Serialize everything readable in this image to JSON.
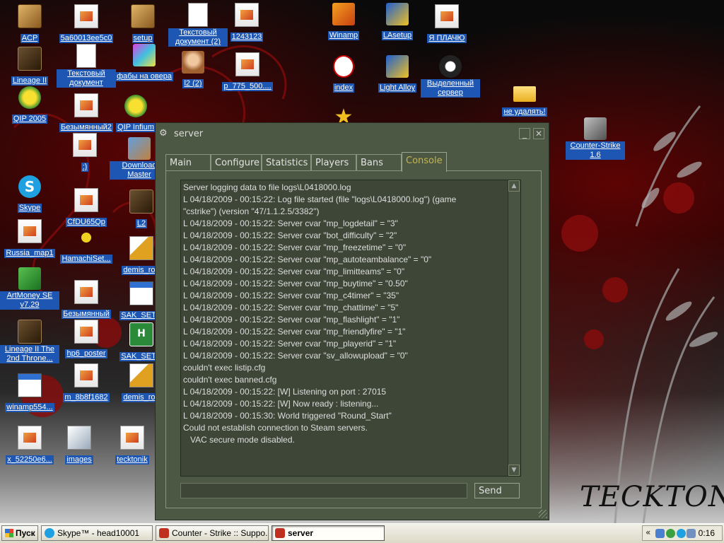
{
  "desktop": {
    "icons": [
      {
        "label": "ACP",
        "kind": "acp"
      },
      {
        "label": "5a60013ee5c0",
        "kind": "file"
      },
      {
        "label": "setup",
        "kind": "acp"
      },
      {
        "label": "Текстовый документ (2)",
        "kind": "doc"
      },
      {
        "label": "1243123",
        "kind": "file"
      },
      {
        "label": "Winamp",
        "kind": "winamp"
      },
      {
        "label": "LAsetup",
        "kind": "la"
      },
      {
        "label": "Я ПЛАЧЮ",
        "kind": "file"
      },
      {
        "label": "Lineage II",
        "kind": "game"
      },
      {
        "label": "Текстовый документ",
        "kind": "doc"
      },
      {
        "label": "фабы на овера",
        "kind": "paint"
      },
      {
        "label": "l2 (2)",
        "kind": "face"
      },
      {
        "label": "p_775_500....",
        "kind": "file"
      },
      {
        "label": "index",
        "kind": "opera"
      },
      {
        "label": "Light Alloy",
        "kind": "la"
      },
      {
        "label": "Выделенный сервер",
        "kind": "server"
      },
      {
        "label": "не удалять!",
        "kind": "folder"
      },
      {
        "label": "QIP 2005",
        "kind": "qip"
      },
      {
        "label": "Безымянный2",
        "kind": "file"
      },
      {
        "label": "QIP Infium",
        "kind": "qip"
      },
      {
        "label": "Counter-Strike 1.6",
        "kind": "cs"
      },
      {
        "label": ":)",
        "kind": "file"
      },
      {
        "label": "Download Master",
        "kind": "pkg"
      },
      {
        "label": "Skype",
        "kind": "skype"
      },
      {
        "label": "CfDU65Qp",
        "kind": "file"
      },
      {
        "label": "L2",
        "kind": "game"
      },
      {
        "label": "Russia_map1",
        "kind": "file"
      },
      {
        "label": "HamachiSet...",
        "kind": "hamachi"
      },
      {
        "label": "demis_rou",
        "kind": "pen"
      },
      {
        "label": "ArtMoney SE v7.29",
        "kind": "money"
      },
      {
        "label": "Безымянный",
        "kind": "file"
      },
      {
        "label": "SAK_SETU",
        "kind": "winexe"
      },
      {
        "label": "Lineage II The 2nd Throne...",
        "kind": "game"
      },
      {
        "label": "hp6_poster",
        "kind": "file"
      },
      {
        "label": "SAK_SETU",
        "kind": "green"
      },
      {
        "label": "winamp554...",
        "kind": "winexe"
      },
      {
        "label": "m_8b8f1682",
        "kind": "file"
      },
      {
        "label": "demis_rou",
        "kind": "pen"
      },
      {
        "label": "x_52250e6...",
        "kind": "file"
      },
      {
        "label": "images",
        "kind": "images"
      },
      {
        "label": "tecktonik",
        "kind": "file"
      }
    ],
    "wallpaper_text": "TECKTONIK"
  },
  "window": {
    "title": "server",
    "minimize": "_",
    "close": "✕",
    "tabs": [
      {
        "label": "Main"
      },
      {
        "label": "Configure"
      },
      {
        "label": "Statistics"
      },
      {
        "label": "Players"
      },
      {
        "label": "Bans"
      },
      {
        "label": "Console"
      }
    ],
    "active_tab": "Console",
    "console_lines": [
      "Server logging data to file logs\\L0418000.log",
      "L 04/18/2009 - 00:15:22: Log file started (file \"logs\\L0418000.log\") (game",
      "\"cstrike\") (version \"47/1.1.2.5/3382\")",
      "L 04/18/2009 - 00:15:22: Server cvar \"mp_logdetail\" = \"3\"",
      "L 04/18/2009 - 00:15:22: Server cvar \"bot_difficulty\" = \"2\"",
      "L 04/18/2009 - 00:15:22: Server cvar \"mp_freezetime\" = \"0\"",
      "L 04/18/2009 - 00:15:22: Server cvar \"mp_autoteambalance\" = \"0\"",
      "L 04/18/2009 - 00:15:22: Server cvar \"mp_limitteams\" = \"0\"",
      "L 04/18/2009 - 00:15:22: Server cvar \"mp_buytime\" = \"0.50\"",
      "L 04/18/2009 - 00:15:22: Server cvar \"mp_c4timer\" = \"35\"",
      "L 04/18/2009 - 00:15:22: Server cvar \"mp_chattime\" = \"5\"",
      "L 04/18/2009 - 00:15:22: Server cvar \"mp_flashlight\" = \"1\"",
      "L 04/18/2009 - 00:15:22: Server cvar \"mp_friendlyfire\" = \"1\"",
      "L 04/18/2009 - 00:15:22: Server cvar \"mp_playerid\" = \"1\"",
      "L 04/18/2009 - 00:15:22: Server cvar \"sv_allowupload\" = \"0\"",
      "couldn't exec listip.cfg",
      "couldn't exec banned.cfg",
      "L 04/18/2009 - 00:15:22: [W] Listening on port : 27015",
      "L 04/18/2009 - 00:15:22: [W] Now ready : listening...",
      "L 04/18/2009 - 00:15:30: World triggered \"Round_Start\"",
      "Could not establish connection to Steam servers.",
      "   VAC secure mode disabled."
    ],
    "command_value": "",
    "send_label": "Send"
  },
  "taskbar": {
    "start_label": "Пуск",
    "tasks": [
      {
        "label": "Skype™ - head10001",
        "icon_color": "#1fa0e0"
      },
      {
        "label": "Counter - Strike :: Suppo...",
        "icon_color": "#c03020"
      },
      {
        "label": "server",
        "icon_color": "#c03020"
      }
    ],
    "clock": "0:16",
    "chevron": "«"
  },
  "colors": {
    "window_bg": "#4c5844",
    "console_bg": "#3e4637",
    "active_tab_text": "#c4b550",
    "icon_label_bg": "#1d56b3"
  }
}
